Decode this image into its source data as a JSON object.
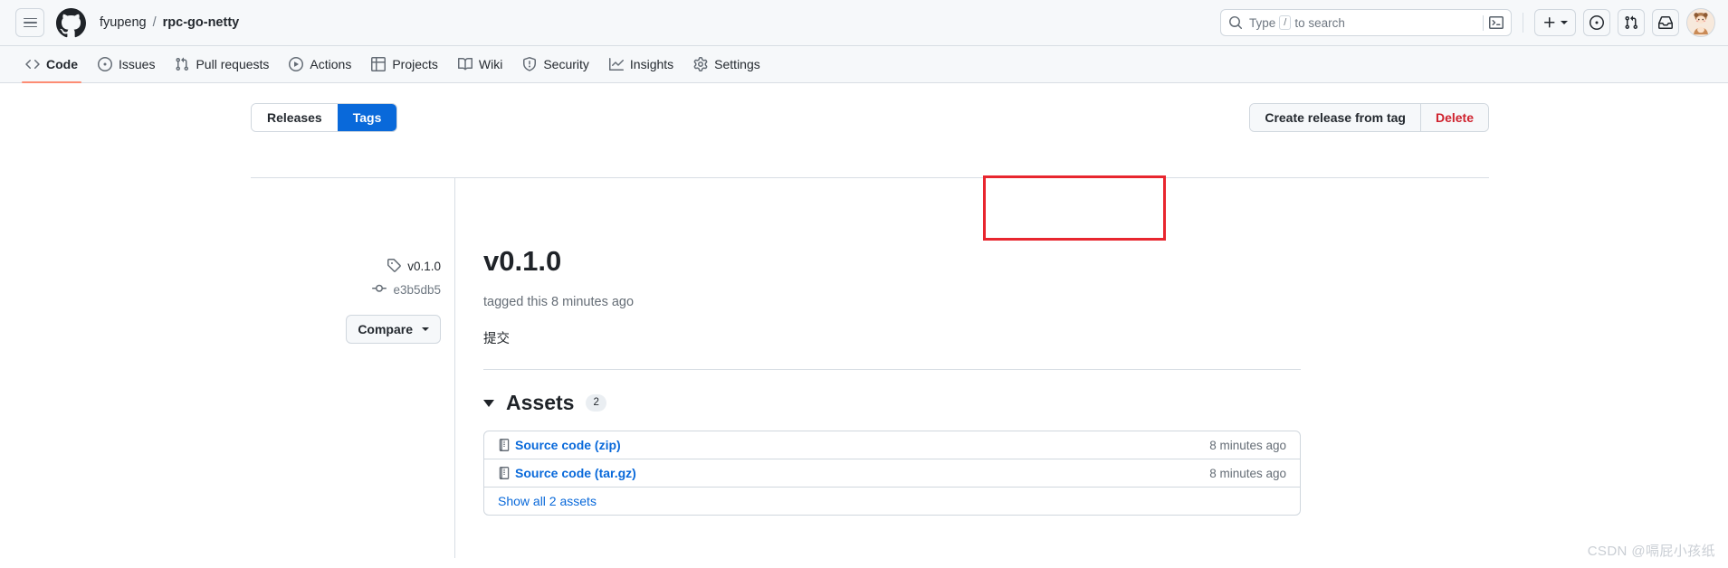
{
  "header": {
    "menu_icon": "hamburger-menu-icon",
    "logo_icon": "github-logo-icon",
    "breadcrumb": {
      "owner": "fyupeng",
      "separator": "/",
      "repo": "rpc-go-netty"
    },
    "search": {
      "placeholder": "Type",
      "key_hint": "/",
      "suffix": "to search",
      "search_icon": "search-icon",
      "terminal_icon": "terminal-icon"
    },
    "actions": {
      "create_new_icon": "plus-icon",
      "create_new_caret": "chevron-down-icon",
      "issues_icon": "issue-opened-icon",
      "pull_requests_icon": "git-pull-request-icon",
      "notifications_icon": "inbox-icon",
      "avatar_icon": "user-avatar"
    }
  },
  "repo_nav": {
    "items": [
      {
        "label": "Code",
        "icon": "code-icon",
        "active": true
      },
      {
        "label": "Issues",
        "icon": "issue-opened-icon",
        "active": false
      },
      {
        "label": "Pull requests",
        "icon": "git-pull-request-icon",
        "active": false
      },
      {
        "label": "Actions",
        "icon": "play-icon",
        "active": false
      },
      {
        "label": "Projects",
        "icon": "table-icon",
        "active": false
      },
      {
        "label": "Wiki",
        "icon": "book-icon",
        "active": false
      },
      {
        "label": "Security",
        "icon": "shield-icon",
        "active": false
      },
      {
        "label": "Insights",
        "icon": "graph-icon",
        "active": false
      },
      {
        "label": "Settings",
        "icon": "gear-icon",
        "active": false
      }
    ]
  },
  "toolbar": {
    "tabs": [
      {
        "label": "Releases",
        "selected": false
      },
      {
        "label": "Tags",
        "selected": true
      }
    ],
    "create_release_label": "Create release from tag",
    "delete_label": "Delete"
  },
  "sidebar": {
    "tag_name": "v0.1.0",
    "tag_icon": "tag-icon",
    "commit_sha": "e3b5db5",
    "commit_icon": "git-commit-icon",
    "compare_label": "Compare",
    "compare_caret": "chevron-down-icon"
  },
  "release": {
    "title": "v0.1.0",
    "meta": "tagged this 8 minutes ago",
    "body": "提交"
  },
  "assets": {
    "title": "Assets",
    "count": "2",
    "collapse_icon": "triangle-down-icon",
    "items": [
      {
        "name": "Source code (zip)",
        "time": "8 minutes ago",
        "icon": "file-zip-icon"
      },
      {
        "name": "Source code (tar.gz)",
        "time": "8 minutes ago",
        "icon": "file-zip-icon"
      }
    ],
    "show_all_label": "Show all 2 assets"
  },
  "watermark": "CSDN @嗝屁小孩纸",
  "colors": {
    "accent": "#0969da",
    "danger": "#cf222e",
    "active_tab_underline": "#fd8c73",
    "highlight_box": "#e8262f",
    "header_bg": "#f6f8fa",
    "border": "#d0d7de"
  }
}
